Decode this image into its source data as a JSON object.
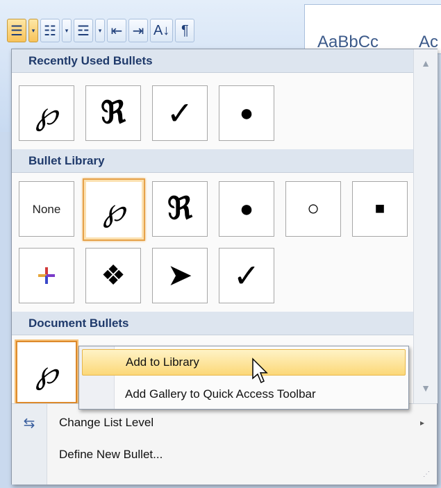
{
  "toolbar": {
    "buttons": [
      {
        "name": "bullets-button",
        "icon": "bullet-list-icon",
        "glyph": "☰"
      },
      {
        "name": "bullets-dropdown",
        "icon": "chevron-down-icon",
        "glyph": "▾"
      },
      {
        "name": "numbering-button",
        "icon": "numbered-list-icon",
        "glyph": "☷"
      },
      {
        "name": "numbering-dropdown",
        "icon": "chevron-down-icon",
        "glyph": "▾"
      },
      {
        "name": "multilevel-button",
        "icon": "multilevel-list-icon",
        "glyph": "☲"
      },
      {
        "name": "multilevel-dropdown",
        "icon": "chevron-down-icon",
        "glyph": "▾"
      },
      {
        "name": "decrease-indent-button",
        "icon": "decrease-indent-icon",
        "glyph": "⇤"
      },
      {
        "name": "increase-indent-button",
        "icon": "increase-indent-icon",
        "glyph": "⇥"
      },
      {
        "name": "sort-button",
        "icon": "sort-az-icon",
        "glyph": "A↓"
      },
      {
        "name": "show-formatting-button",
        "icon": "pilcrow-icon",
        "glyph": "¶"
      }
    ],
    "styles_preview": [
      "AaBbCc",
      "Ac"
    ]
  },
  "menu": {
    "recent_header": "Recently Used Bullets",
    "recent": [
      {
        "name": "recent-bullet-script-p",
        "glyph": "℘",
        "style": "script"
      },
      {
        "name": "recent-bullet-fraktur-r",
        "glyph": "ℜ",
        "style": "frak"
      },
      {
        "name": "recent-bullet-checkmark",
        "glyph": "✓",
        "style": "check"
      },
      {
        "name": "recent-bullet-dot",
        "glyph": "●",
        "style": "dot"
      }
    ],
    "library_header": "Bullet Library",
    "library": [
      {
        "name": "library-bullet-none",
        "glyph": "None",
        "style": "none"
      },
      {
        "name": "library-bullet-script-p",
        "glyph": "℘",
        "style": "script",
        "selected": true
      },
      {
        "name": "library-bullet-fraktur-r",
        "glyph": "ℜ",
        "style": "frak"
      },
      {
        "name": "library-bullet-dot",
        "glyph": "●",
        "style": "dot"
      },
      {
        "name": "library-bullet-circle",
        "glyph": "○",
        "style": "circle"
      },
      {
        "name": "library-bullet-square",
        "glyph": "■",
        "style": "square"
      },
      {
        "name": "library-bullet-star",
        "glyph": "✦",
        "style": "star"
      },
      {
        "name": "library-bullet-diamonds",
        "glyph": "❖",
        "style": "diamonds"
      },
      {
        "name": "library-bullet-arrow",
        "glyph": "➤",
        "style": "arrow"
      },
      {
        "name": "library-bullet-checkmark",
        "glyph": "✓",
        "style": "check"
      }
    ],
    "document_header": "Document Bullets",
    "document": [
      {
        "name": "document-bullet-script-p",
        "glyph": "℘",
        "style": "script"
      }
    ],
    "items": {
      "change_level": "Change List Level",
      "define_new": "Define New Bullet..."
    },
    "scroll_up": "▲",
    "scroll_down": "▼",
    "submenu_arrow": "▸"
  },
  "context_menu": {
    "add_to_library": "Add to Library",
    "add_gallery": "Add Gallery to Quick Access Toolbar"
  },
  "colors": {
    "accent": "#f8c35a",
    "header_text": "#1f3a6b"
  }
}
